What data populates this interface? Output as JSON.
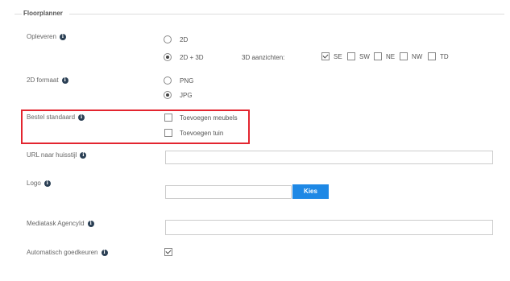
{
  "section_title": "Floorplanner",
  "info_glyph": "i",
  "opleveren": {
    "label": "Opleveren",
    "options": [
      "2D",
      "2D + 3D"
    ],
    "selected": "2D + 3D",
    "views_label": "3D aanzichten:",
    "views": [
      {
        "label": "SE",
        "checked": true
      },
      {
        "label": "SW",
        "checked": false
      },
      {
        "label": "NE",
        "checked": false
      },
      {
        "label": "NW",
        "checked": false
      },
      {
        "label": "TD",
        "checked": false
      }
    ]
  },
  "formaat": {
    "label": "2D formaat",
    "options": [
      "PNG",
      "JPG"
    ],
    "selected": "JPG"
  },
  "bestel": {
    "label": "Bestel standaard",
    "options": [
      {
        "label": "Toevoegen meubels",
        "checked": false
      },
      {
        "label": "Toevoegen tuin",
        "checked": false
      }
    ],
    "highlight_color": "#e3252f"
  },
  "huisstijl": {
    "label": "URL naar huisstijl",
    "value": ""
  },
  "logo": {
    "label": "Logo",
    "value": "",
    "button": "Kies"
  },
  "agency": {
    "label": "Mediatask AgencyId",
    "value": ""
  },
  "auto": {
    "label": "Automatisch goedkeuren",
    "checked": true
  },
  "colors": {
    "button": "#1e88e5",
    "info": "#2a3f54"
  }
}
